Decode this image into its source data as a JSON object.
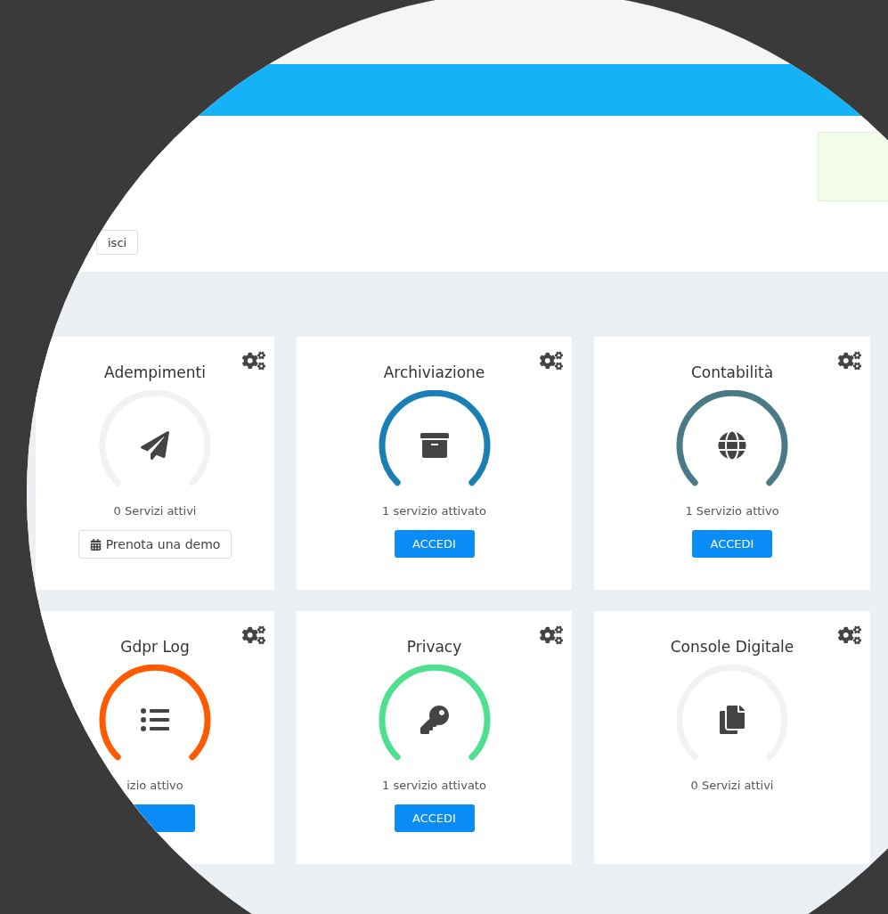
{
  "header": {
    "button": "isci"
  },
  "cards": [
    {
      "title": "Adempimenti",
      "color": "#f2f2f2",
      "status": "0 Servizi attivi",
      "action": {
        "kind": "demo",
        "label": "Prenota una demo"
      }
    },
    {
      "title": "Archiviazione",
      "color": "#1a7fb5",
      "status": "1 servizio attivato",
      "action": {
        "kind": "access",
        "label": "ACCEDI"
      }
    },
    {
      "title": "Contabilità",
      "color": "#4a7a86",
      "status": "1 Servizio attivo",
      "action": {
        "kind": "access",
        "label": "ACCEDI"
      }
    },
    {
      "title": "Gdpr Log",
      "color": "#ff5a00",
      "status": "izio attivo",
      "action": {
        "kind": "access"
      }
    },
    {
      "title": "Privacy",
      "color": "#4fe08f",
      "status": "1 servizio attivato",
      "action": {
        "kind": "access",
        "label": "ACCEDI"
      }
    },
    {
      "title": "Console Digitale",
      "color": "#f2f2f2",
      "status": "0 Servizi attivi"
    }
  ]
}
